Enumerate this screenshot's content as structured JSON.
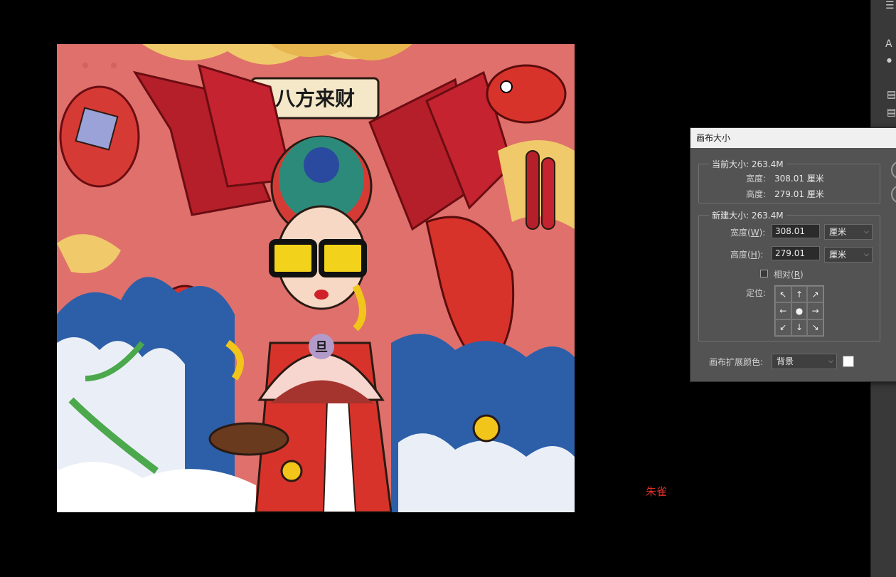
{
  "dialog": {
    "title": "画布大小",
    "current_size": {
      "legend": "当前大小: 263.4M",
      "width_label": "宽度:",
      "width_value": "308.01 厘米",
      "height_label": "高度:",
      "height_value": "279.01 厘米"
    },
    "new_size": {
      "legend": "新建大小: 263.4M",
      "width_label_pre": "宽度(",
      "width_label_key": "W",
      "width_label_post": "):",
      "width_value": "308.01",
      "width_unit": "厘米",
      "height_label_pre": "高度(",
      "height_label_key": "H",
      "height_label_post": "):",
      "height_value": "279.01",
      "height_unit": "厘米",
      "relative_label_pre": "相对(",
      "relative_label_key": "R",
      "relative_label_post": ")",
      "relative_checked": false,
      "anchor_label": "定位:",
      "anchor_arrows": [
        "↖",
        "↑",
        "↗",
        "←",
        "●",
        "→",
        "↙",
        "↓",
        "↘"
      ]
    },
    "extension_color": {
      "label": "画布扩展颜色:",
      "value": "背景",
      "swatch_color": "#ffffff"
    }
  },
  "artwork": {
    "banner_text": "八方来财",
    "fan_text": "旦"
  },
  "watermark": "朱雀",
  "panel_strip": {
    "glyphs": [
      "A",
      "●"
    ]
  },
  "colors": {
    "dialog_bg": "#535353",
    "titlebar_bg": "#f0f0f0",
    "watermark": "#e0302b",
    "art_pink": "#e0706c"
  }
}
